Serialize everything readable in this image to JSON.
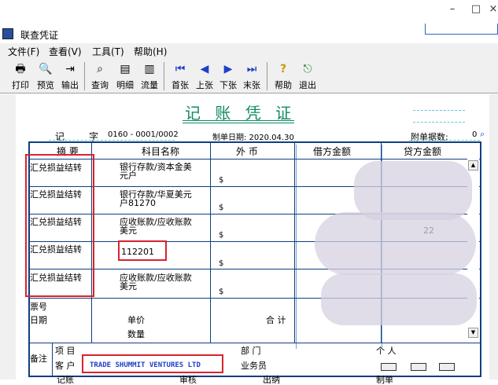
{
  "window": {
    "title": "联查凭证",
    "minimize": "–",
    "maximize": "□",
    "close": "×"
  },
  "menu": [
    {
      "label": "文件(F)"
    },
    {
      "label": "查看(V)"
    },
    {
      "label": "工具(T)"
    },
    {
      "label": "帮助(H)"
    }
  ],
  "toolbar": [
    {
      "label": "打印",
      "icon": "printer-icon",
      "glyph": "🖶"
    },
    {
      "label": "预览",
      "icon": "preview-icon",
      "glyph": "🔍"
    },
    {
      "label": "输出",
      "icon": "export-icon",
      "glyph": "⇥"
    },
    {
      "label": "查询",
      "icon": "binoculars-icon",
      "glyph": "⌕"
    },
    {
      "label": "明细",
      "icon": "detail-icon",
      "glyph": "▤"
    },
    {
      "label": "流量",
      "icon": "flow-icon",
      "glyph": "▥"
    },
    {
      "label": "首张",
      "icon": "first-icon",
      "glyph": "⏮"
    },
    {
      "label": "上张",
      "icon": "prev-icon",
      "glyph": "◀"
    },
    {
      "label": "下张",
      "icon": "next-icon",
      "glyph": "▶"
    },
    {
      "label": "末张",
      "icon": "last-icon",
      "glyph": "⏭"
    },
    {
      "label": "帮助",
      "icon": "help-icon",
      "glyph": "?"
    },
    {
      "label": "退出",
      "icon": "exit-icon",
      "glyph": "⎋"
    }
  ],
  "voucher": {
    "title": "记 账 凭 证",
    "type_char1": "记",
    "type_char2": "字",
    "number": "0160 - 0001/0002",
    "date": "制单日期: 2020.04.30",
    "attachments_label": "附单据数:",
    "attachments": "0"
  },
  "headers": {
    "summary": "摘 要",
    "account": "科目名称",
    "foreign": "外 币",
    "debit": "借方金额",
    "credit": "贷方金额"
  },
  "rows": [
    {
      "summary": "汇兑损益结转",
      "account1": "银行存款/资本金美",
      "account2": "元户",
      "currency": "$"
    },
    {
      "summary": "汇兑损益结转",
      "account1": "银行存款/华夏美元",
      "account2": "户81270",
      "currency": "$"
    },
    {
      "summary": "汇兑损益结转",
      "account1": "应收账款/应收账款",
      "account2": "美元",
      "currency": "$"
    },
    {
      "summary": "汇兑损益结转",
      "account1": "",
      "account2": "",
      "currency": "$"
    },
    {
      "summary": "汇兑损益结转",
      "account1": "应收账款/应收账款",
      "account2": "美元",
      "currency": "$"
    }
  ],
  "edit_value": "112201",
  "partial_number": "22",
  "footer": {
    "bill_no": "票号",
    "date": "日期",
    "price": "单价",
    "qty": "数量",
    "total": "合 计",
    "remark": "备注",
    "project": "项 目",
    "customer": "客 户",
    "dept": "部 门",
    "staff": "业务员",
    "person": "个 人",
    "customer_name": "TRADE SHUMMIT VENTURES LTD"
  },
  "bottom": {
    "a": "记账",
    "b": "审核",
    "c": "出纳",
    "d": "制单"
  },
  "colors": {
    "green": "#0f8a63",
    "blue": "#0f3f80",
    "red": "#d9232e"
  }
}
